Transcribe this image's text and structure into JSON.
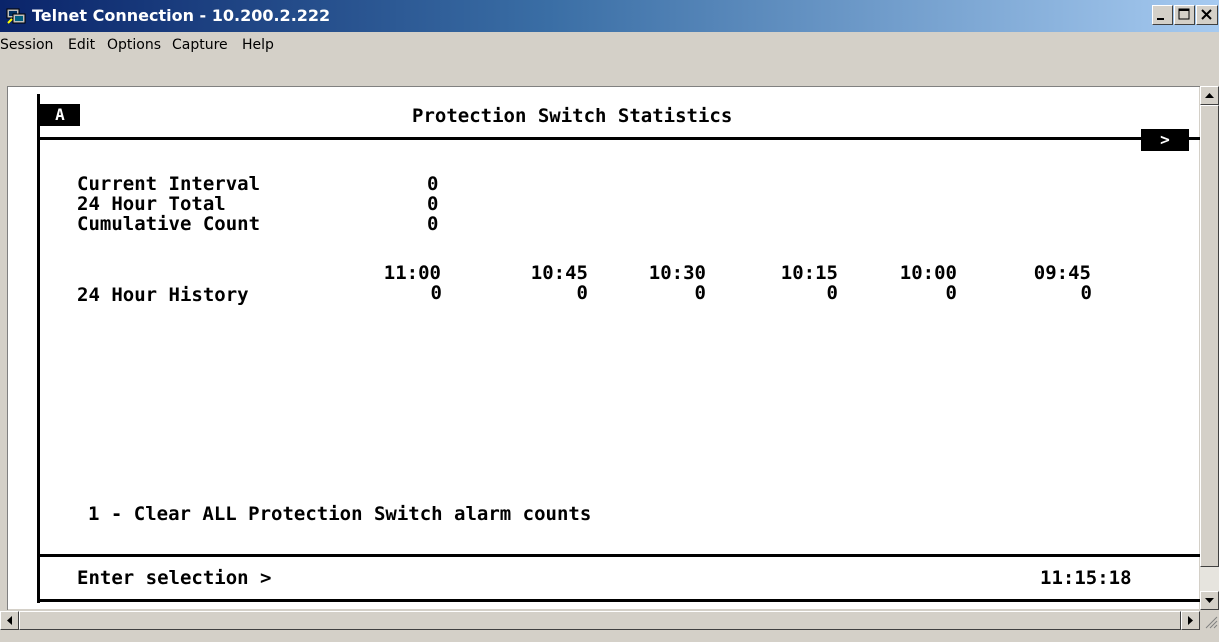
{
  "window": {
    "title": "Telnet Connection - 10.200.2.222"
  },
  "menu": [
    "Session",
    "Edit",
    "Options",
    "Capture",
    "Help"
  ],
  "screen": {
    "badge": "A",
    "title": "Protection Switch Statistics",
    "nav_arrow": ">",
    "stats": [
      {
        "label": "Current Interval",
        "value": "0"
      },
      {
        "label": "24 Hour Total",
        "value": "0"
      },
      {
        "label": "Cumulative Count",
        "value": "0"
      }
    ],
    "history": {
      "label": "24 Hour History",
      "times": [
        "11:00",
        "10:45",
        "10:30",
        "10:15",
        "10:00",
        "09:45"
      ],
      "values": [
        "0",
        "0",
        "0",
        "0",
        "0",
        "0"
      ]
    },
    "option": "1 - Clear ALL Protection Switch alarm counts",
    "prompt": "Enter selection >",
    "clock": "11:15:18"
  }
}
